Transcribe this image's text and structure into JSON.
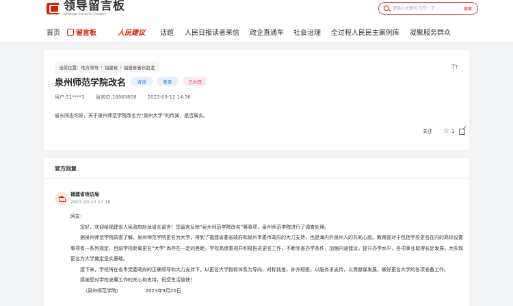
{
  "header": {
    "logo_title": "领导留言板",
    "logo_subtitle": "Message Board for Leaders",
    "search_placeholder": "请输入关键词 回车一下",
    "search_button": "搜索"
  },
  "nav": {
    "items": [
      "首页",
      "留言板",
      "人民建议",
      "话题",
      "人民日报读者来信",
      "政企直通车",
      "社会治理",
      "全过程人民民主案例库",
      "凝聚服务群众"
    ]
  },
  "message": {
    "breadcrumb": [
      "当前位置:",
      "地方领导",
      "福建省",
      "福建省省长赵龙"
    ],
    "title": "泉州师范学院改名",
    "tags": [
      "咨询",
      "教育",
      "已办理"
    ],
    "user": "用户:51****3",
    "message_id": "留言ID:18869808",
    "date": "2023-09-12 14:36",
    "content": "省长同志你好，关于泉州师范学院改名为“泉州大学”的传闻，是否属实。",
    "follow_label": "关注",
    "star_count": "1"
  },
  "reply": {
    "section_title": "官方回复",
    "org": "福建省信访局",
    "date": "2023-10-10 17:18",
    "paragraphs": [
      "网友:",
      "您好，欢迎给福建省人民政府赵龙省长留言！您留言反映“泉州师范学院改名”等事项，泉州师范学院进行了调查处理。",
      "据泉州师范学院调查了解，泉州师范学院更名为大学，得到了福建省委省政府和泉州市委市政府的大力支持，也是海内外泉州人的共同心愿。教育部对于包括学校更名在内的高校设置事项有一系列规定，目前学校距离更名“大学”尚存在一定的差距。学校高度重视并积极推进更名工作，不断完善办学条件，加强内涵建设，提升办学水平，各项事业取得长足发展，为实现更名为大学奠定坚实基础。",
      "接下来，学校将在省市党委政府的正确领导和大力支持下，以更名大学指标体系为导向，对标找差，补齐短板，以服务求支持，以贡献谋发展，做好更名大学的各项准备工作。",
      "感谢您对学校发展工作的关心和支持，祝您生活愉快！"
    ],
    "signature_org": "（泉州师范学院）",
    "signature_date": "2023年9月20日"
  },
  "icons": {
    "font_size": "tt-icon",
    "star": "star-icon",
    "share": "share-icon",
    "org": "building-icon",
    "search": "search-icon"
  },
  "colors": {
    "brand_red": "#d81e06",
    "tag_blue": "#3a7bd5",
    "tag_red": "#e04b4b"
  }
}
